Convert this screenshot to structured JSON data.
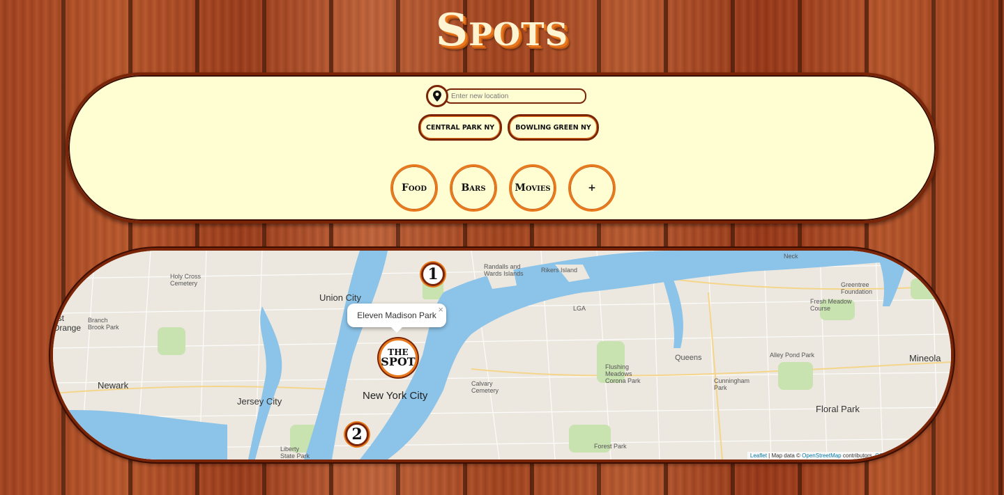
{
  "app": {
    "title": "Spots"
  },
  "search": {
    "placeholder": "Enter new location",
    "icon": "location-pin-icon"
  },
  "saved_locations": [
    "Central Park NY",
    "Bowling Green NY"
  ],
  "categories": [
    "Food",
    "Bars",
    "Movies",
    "+"
  ],
  "map": {
    "popup": {
      "title": "Eleven Madison Park",
      "close": "×"
    },
    "spot_marker": {
      "line1": "THE",
      "line2": "SPOT"
    },
    "numbered_markers": [
      "1",
      "2"
    ],
    "labels": {
      "new_york_city": "New York City",
      "newark": "Newark",
      "jersey_city": "Jersey City",
      "union_city": "Union City",
      "floral_park": "Floral Park",
      "mineola": "Mineola",
      "queens": "Queens",
      "alley_pond_park": "Alley Pond Park",
      "flushing_meadows": "Flushing Meadows Corona Park",
      "cunningham_park": "Cunningham Park",
      "fresh_meadow": "Fresh Meadow Course",
      "greentree": "Greentree Foundation",
      "rikers": "Rikers Island",
      "randalls": "Randalls and Wards Islands",
      "lga": "LGA",
      "holy_cross": "Holy Cross Cemetery",
      "branch_brook": "Branch Brook Park",
      "calvary": "Calvary Cemetery",
      "liberty_state": "Liberty State Park",
      "forest_park": "Forest Park",
      "east_orange": "ast Orange",
      "neck": "Neck"
    },
    "attribution": {
      "leaflet": "Leaflet",
      "text": " | Map data © ",
      "osm": "OpenStreetMap",
      "contributors": " contributors, ",
      "cc": "CC-BY"
    }
  }
}
